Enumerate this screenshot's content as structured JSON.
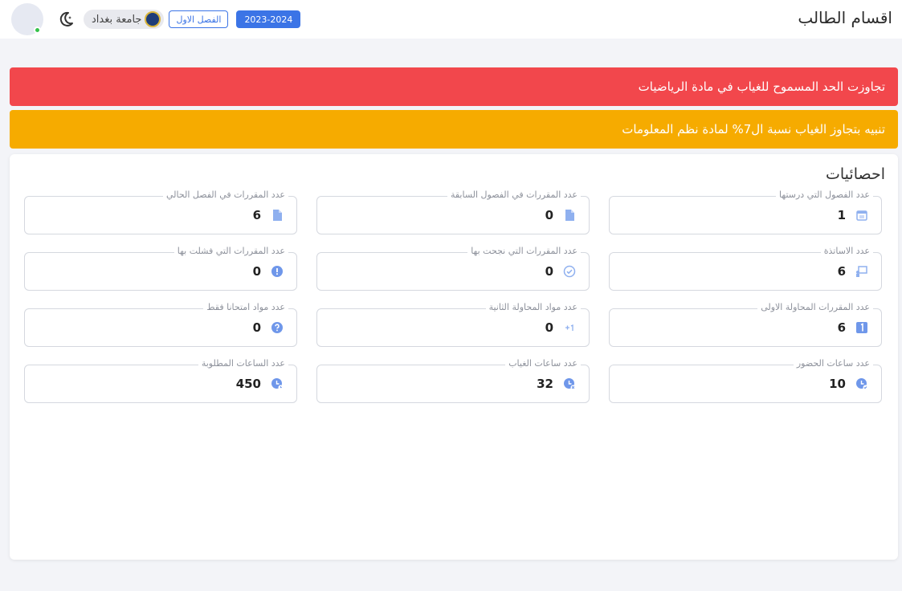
{
  "header": {
    "title": "اقسام الطالب",
    "university": "جامعة بغداد",
    "semester": "الفصل الاول",
    "year": "2023-2024"
  },
  "alerts": [
    {
      "text": "تجاوزت الحد المسموح للغياب في مادة الرياضيات",
      "type": "danger",
      "color": "#f2474c"
    },
    {
      "text": "تنبيه بتجاوز الغياب نسبة ال7% لمادة نظم المعلومات",
      "type": "warning",
      "color": "#f6ab00"
    }
  ],
  "stats_card": {
    "title": "احصائيات",
    "items": [
      {
        "label": "عدد الفصول التي درستها",
        "value": "1",
        "icon": "calendar-icon"
      },
      {
        "label": "عدد المقررات في الفصول السابقة",
        "value": "0",
        "icon": "file-icon"
      },
      {
        "label": "عدد المقررات في الفصل الحالي",
        "value": "6",
        "icon": "file-icon"
      },
      {
        "label": "عدد الاساتذة",
        "value": "6",
        "icon": "presentation-icon"
      },
      {
        "label": "عدد المقررات التي نجحت بها",
        "value": "0",
        "icon": "check-circle-icon"
      },
      {
        "label": "عدد المقررات التي فشلت بها",
        "value": "0",
        "icon": "info-circle-icon"
      },
      {
        "label": "عدد المقررات المحاولة الاولى",
        "value": "6",
        "icon": "number-one-icon"
      },
      {
        "label": "عدد مواد المحاولة الثانية",
        "value": "0",
        "icon": "plus-one-icon"
      },
      {
        "label": "عدد مواد امتحانا فقط",
        "value": "0",
        "icon": "question-circle-icon"
      },
      {
        "label": "عدد ساعات الحضور",
        "value": "10",
        "icon": "clock-check-icon"
      },
      {
        "label": "عدد ساعات الغياب",
        "value": "32",
        "icon": "clock-x-icon"
      },
      {
        "label": "عدد الساعات المطلوبة",
        "value": "450",
        "icon": "clock-icon"
      }
    ]
  },
  "colors": {
    "accent": "#3b74e6",
    "icon": "#8fb0ef",
    "danger": "#f2474c",
    "warning": "#f6ab00",
    "online": "#35c24a"
  }
}
